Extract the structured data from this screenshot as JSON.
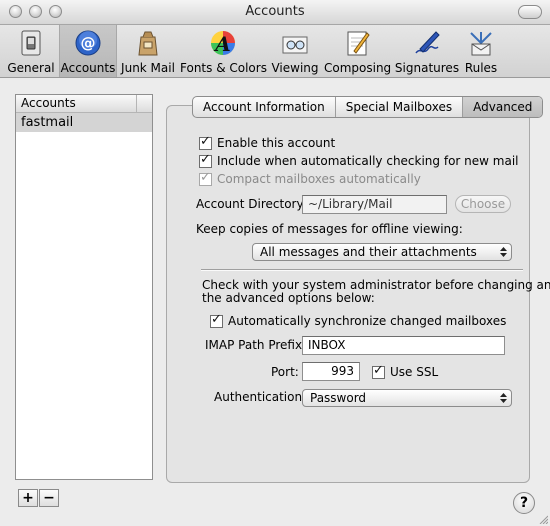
{
  "window": {
    "title": "Accounts"
  },
  "toolbar": {
    "items": [
      {
        "label": "General",
        "icon": "light-switch-icon"
      },
      {
        "label": "Accounts",
        "icon": "at-sign-icon"
      },
      {
        "label": "Junk Mail",
        "icon": "junk-bag-icon"
      },
      {
        "label": "Fonts & Colors",
        "icon": "font-color-icon"
      },
      {
        "label": "Viewing",
        "icon": "glasses-icon"
      },
      {
        "label": "Composing",
        "icon": "pencil-paper-icon"
      },
      {
        "label": "Signatures",
        "icon": "pen-signature-icon"
      },
      {
        "label": "Rules",
        "icon": "rules-envelope-icon"
      }
    ],
    "selected": "Accounts"
  },
  "accounts": {
    "header": "Accounts",
    "items": [
      "fastmail"
    ],
    "add_label": "+",
    "remove_label": "−"
  },
  "tabs": [
    "Account Information",
    "Special Mailboxes",
    "Advanced"
  ],
  "active_tab": "Advanced",
  "advanced": {
    "enable_account": "Enable this account",
    "include_checking": "Include when automatically checking for new mail",
    "compact_mailboxes": "Compact mailboxes automatically",
    "account_directory_label": "Account Directory:",
    "account_directory_value": "~/Library/Mail",
    "choose_label": "Choose",
    "keep_copies_label": "Keep copies of messages for offline viewing:",
    "keep_copies_value": "All messages and their attachments",
    "admin_note_line1": "Check with your system administrator before changing any of",
    "admin_note_line2": "the advanced options below:",
    "sync_mailboxes": "Automatically synchronize changed mailboxes",
    "imap_prefix_label": "IMAP Path Prefix:",
    "imap_prefix_value": "INBOX",
    "port_label": "Port:",
    "port_value": "993",
    "use_ssl": "Use SSL",
    "auth_label": "Authentication:",
    "auth_value": "Password"
  },
  "help_label": "?"
}
